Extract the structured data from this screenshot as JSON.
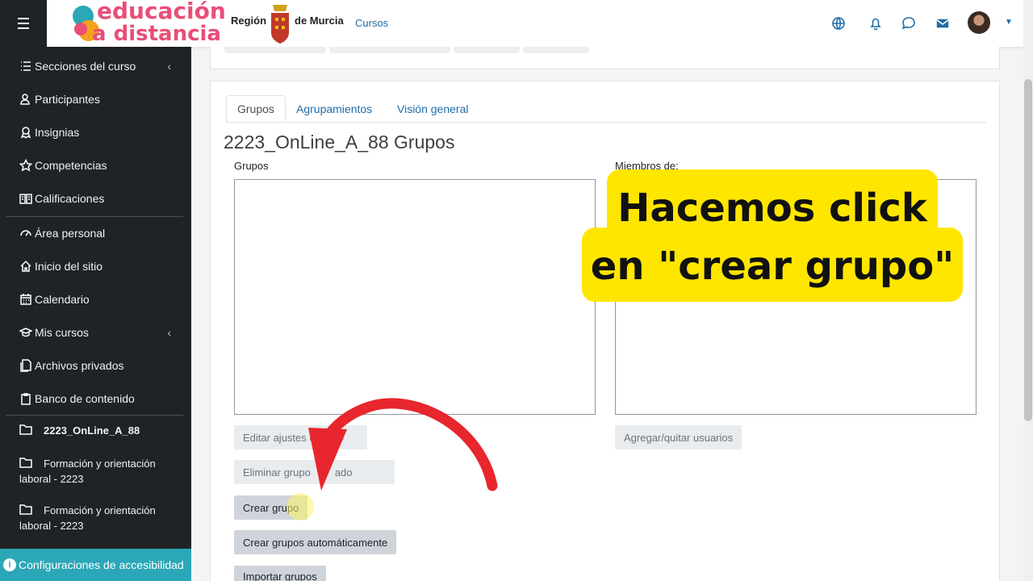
{
  "sidebar": {
    "items": [
      {
        "label": "Secciones del curso",
        "icon": "list-icon",
        "has_chevron": true
      },
      {
        "label": "Participantes",
        "icon": "users-icon"
      },
      {
        "label": "Insignias",
        "icon": "badge-icon"
      },
      {
        "label": "Competencias",
        "icon": "star-icon"
      },
      {
        "label": "Calificaciones",
        "icon": "book-icon"
      },
      {
        "label": "Área personal",
        "icon": "dashboard-icon"
      },
      {
        "label": "Inicio del sitio",
        "icon": "home-icon"
      },
      {
        "label": "Calendario",
        "icon": "calendar-icon"
      },
      {
        "label": "Mis cursos",
        "icon": "graduation-cap-icon",
        "has_chevron": true
      },
      {
        "label": "Archivos privados",
        "icon": "files-icon"
      },
      {
        "label": "Banco de contenido",
        "icon": "clipboard-icon"
      }
    ],
    "courses": [
      {
        "label": "2223_OnLine_A_88"
      },
      {
        "label": "Formación y orientación laboral - 2223"
      },
      {
        "label": "Formación y orientación laboral - 2223"
      }
    ],
    "chevron": "‹",
    "accessibility": "Configuraciones de accesibilidad"
  },
  "navbar": {
    "logo_line1": "educación",
    "logo_line2": "a distancia",
    "region_left": "Región",
    "region_right": "de Murcia",
    "cursos_link": "Cursos",
    "icons": [
      "globe-icon",
      "bell-icon",
      "chat-icon",
      "mail-icon"
    ]
  },
  "tabs": [
    {
      "label": "Grupos",
      "active": true
    },
    {
      "label": "Agrupamientos",
      "active": false
    },
    {
      "label": "Visión general",
      "active": false
    }
  ],
  "page": {
    "title": "2223_OnLine_A_88 Grupos",
    "groups_label": "Grupos",
    "members_label": "Miembros de:"
  },
  "buttons": {
    "edit": "Editar ajustes del grupo seleccionado",
    "edit_visible": "Editar ajustes d",
    "edit_tail": "o",
    "delete": "Eliminar grupo seleccionado",
    "delete_visible": "Eliminar grupo",
    "delete_tail": "ado",
    "create": "Crear grupo",
    "auto": "Crear grupos automáticamente",
    "import": "Importar grupos",
    "add_remove": "Agregar/quitar usuarios"
  },
  "annotation": {
    "line1": "Hacemos click",
    "line2": "en \"crear grupo\"",
    "color": "#ffe600",
    "arrow_color": "#e8262d"
  }
}
